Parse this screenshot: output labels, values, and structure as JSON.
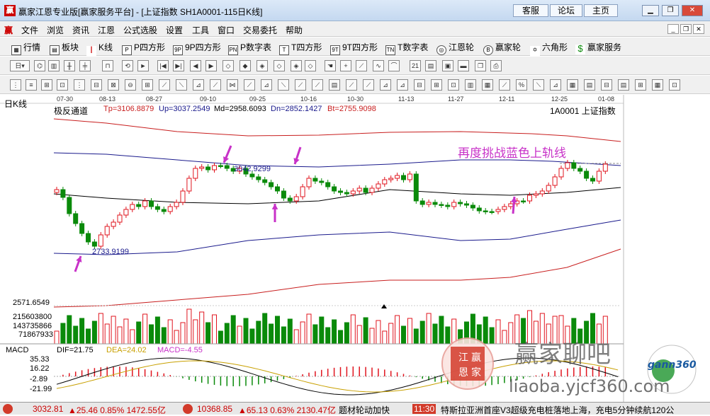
{
  "window": {
    "title": "赢家江恩专业版[赢家服务平台] - [上证指数  SH1A0001-115日K线]",
    "logo": "赢",
    "buttons": [
      "客服",
      "论坛",
      "主页"
    ]
  },
  "menu": {
    "logo": "赢",
    "items": [
      "文件",
      "浏览",
      "资讯",
      "江恩",
      "公式选股",
      "设置",
      "工具",
      "窗口",
      "交易委托",
      "帮助"
    ]
  },
  "toolbar1": {
    "items": [
      {
        "icon": "grid-icon",
        "label": "行情"
      },
      {
        "icon": "blocks-icon",
        "label": "板块"
      },
      {
        "icon": "candle-icon",
        "label": "K线"
      },
      {
        "icon": "P",
        "label": "P四方形"
      },
      {
        "icon": "9P",
        "label": "9P四方形"
      },
      {
        "icon": "PN",
        "label": "P数字表"
      },
      {
        "icon": "T",
        "label": "T四方形"
      },
      {
        "icon": "9T",
        "label": "9T四方形"
      },
      {
        "icon": "TN",
        "label": "T数字表"
      },
      {
        "icon": "gann-wheel-icon",
        "label": "江恩轮"
      },
      {
        "icon": "winner-wheel-icon",
        "label": "赢家轮"
      },
      {
        "icon": "hexagram-icon",
        "label": "六角形"
      },
      {
        "icon": "dollar-icon",
        "label": "赢家服务"
      }
    ]
  },
  "chart": {
    "period_label": "日K线",
    "indicator": "极反通道",
    "params": {
      "tp": "Tp=3106.8879",
      "up": "Up=3037.2549",
      "md": "Md=2958.6093",
      "dn": "Dn=2852.1427",
      "bt": "Bt=2755.9098"
    },
    "stock": "1A0001  上证指数",
    "dates": [
      "07-30",
      "08-13",
      "08-27",
      "09-10",
      "09-25",
      "10-16",
      "10-30",
      "11-13",
      "11-27",
      "12-11",
      "12-25",
      "01-08"
    ],
    "annotation": "再度挑战蓝色上轨线",
    "high_label": "3042.9299",
    "low_label": "2733.9199",
    "vol_labels": [
      "2571.6549",
      "215603800",
      "143735866",
      "71867933"
    ],
    "macd_header": {
      "name": "MACD",
      "dif": "DIF=21.75",
      "dea": "DEA=24.02",
      "macd": "MACD=-4.55"
    },
    "macd_axis": [
      "35.33",
      "16.22",
      "-2.89",
      "-21.99"
    ]
  },
  "watermark": {
    "seal": [
      "江",
      "赢",
      "恩",
      "家"
    ],
    "brand": "赢家聊吧",
    "url": "liaoba.yjcf360.com",
    "gann": "gann360"
  },
  "status": {
    "sh": "3032.81",
    "sh_chg": "▲25.46 0.85% 1472.55亿",
    "sz": "10368.85",
    "sz_chg": "▲65.13 0.63% 2130.47亿",
    "ticker": "题材轮动加快",
    "time": "11:30",
    "news": "特斯拉亚洲首座V3超级充电桩落地上海，充电5分钟续航120公"
  },
  "colors": {
    "up": "#e0141e",
    "down": "#0a8a0a",
    "channel_blue": "#1a1a8c",
    "channel_red": "#c81e1e",
    "arrow": "#c832c8"
  }
}
